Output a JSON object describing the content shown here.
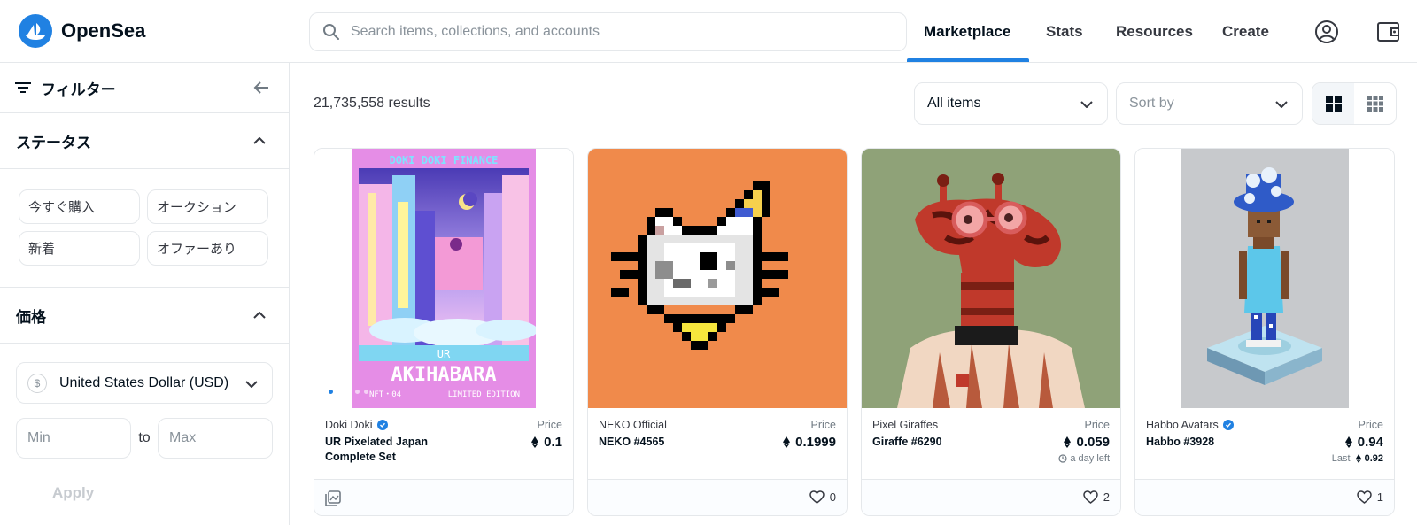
{
  "header": {
    "brand": "OpenSea",
    "search_placeholder": "Search items, collections, and accounts",
    "nav": [
      "Marketplace",
      "Stats",
      "Resources",
      "Create"
    ],
    "active_nav": "Marketplace"
  },
  "sidebar": {
    "filter_title": "フィルター",
    "status_title": "ステータス",
    "status_options": [
      "今すぐ購入",
      "オークション",
      "新着",
      "オファーあり"
    ],
    "price_title": "価格",
    "currency": "United States Dollar (USD)",
    "currency_symbol": "$",
    "min_placeholder": "Min",
    "to_label": "to",
    "max_placeholder": "Max",
    "apply_label": "Apply"
  },
  "main": {
    "results": "21,735,558 results",
    "items_select": "All items",
    "sort_placeholder": "Sort by"
  },
  "cards": [
    {
      "collection": "Doki Doki",
      "verified": true,
      "name": "UR Pixelated Japan Complete Set",
      "price_label": "Price",
      "price": "0.1",
      "extra": "",
      "likes": ""
    },
    {
      "collection": "NEKO Official",
      "verified": false,
      "name": "NEKO #4565",
      "price_label": "Price",
      "price": "0.1999",
      "extra": "",
      "likes": "0"
    },
    {
      "collection": "Pixel Giraffes",
      "verified": false,
      "name": "Giraffe #6290",
      "price_label": "Price",
      "price": "0.059",
      "extra": "a day left",
      "likes": "2"
    },
    {
      "collection": "Habbo Avatars",
      "verified": true,
      "name": "Habbo #3928",
      "price_label": "Price",
      "price": "0.94",
      "extra_label": "Last",
      "extra": "0.92",
      "likes": "1"
    }
  ],
  "artwork_text": {
    "doki_top": "DOKI DOKI FINANCE",
    "doki_tag": "UR",
    "doki_title": "AKIHABARA",
    "doki_sub_left": "NFT・04",
    "doki_sub_right": "LIMITED EDITION"
  },
  "colors": {
    "accent": "#2081e2",
    "neko_bg": "#f08a4b",
    "giraffe_bg": "#8fa278",
    "habbo_bg": "#c7c9cc"
  }
}
